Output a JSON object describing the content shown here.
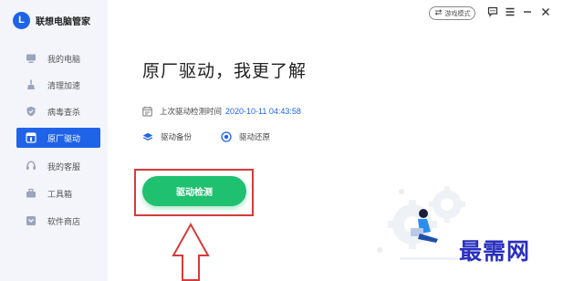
{
  "app": {
    "logo_letter": "L",
    "name": "联想电脑管家"
  },
  "titlebar": {
    "game_mode_label": "游戏模式",
    "icons": [
      "swap-icon",
      "feedback-icon",
      "menu-icon",
      "minimize-icon",
      "close-icon"
    ]
  },
  "sidebar": {
    "items": [
      {
        "label": "我的电脑",
        "icon": "computer-icon",
        "active": false
      },
      {
        "label": "清理加速",
        "icon": "broom-icon",
        "active": false
      },
      {
        "label": "病毒查杀",
        "icon": "shield-icon",
        "active": false
      },
      {
        "label": "原厂驱动",
        "icon": "driver-icon",
        "active": true
      },
      {
        "label": "我的客服",
        "icon": "support-icon",
        "active": false
      },
      {
        "label": "工具箱",
        "icon": "toolbox-icon",
        "active": false
      },
      {
        "label": "软件商店",
        "icon": "store-icon",
        "active": false
      }
    ]
  },
  "main": {
    "title": "原厂驱动，我更了解",
    "last_check_label": "上次驱动检测时间",
    "last_check_value": "2020-10-11 04:43:58",
    "backup_label": "驱动备份",
    "restore_label": "驱动还原",
    "detect_button": "驱动检测"
  },
  "watermark": "最需网",
  "colors": {
    "accent": "#1f63e8",
    "button_green": "#1fc070",
    "highlight_red": "#d63a3a",
    "sidebar_bg": "#f3f5fa",
    "watermark": "#2a2fbf"
  }
}
